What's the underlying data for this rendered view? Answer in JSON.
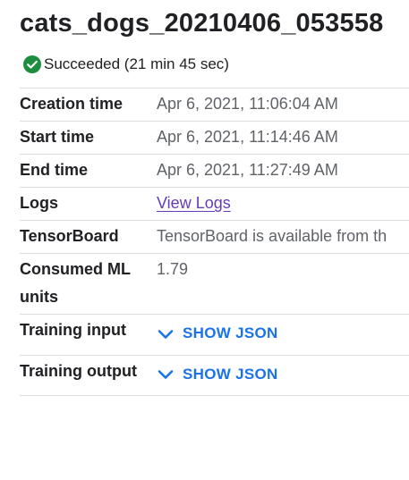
{
  "job": {
    "title": "cats_dogs_20210406_053558",
    "status_text": "Succeeded (21 min 45 sec)",
    "status_icon": "check-circle-icon",
    "status_color": "#1e8e3e"
  },
  "details": {
    "creation_time_label": "Creation time",
    "creation_time_value": "Apr 6, 2021, 11:06:04 AM",
    "start_time_label": "Start time",
    "start_time_value": "Apr 6, 2021, 11:14:46 AM",
    "end_time_label": "End time",
    "end_time_value": "Apr 6, 2021, 11:27:49 AM",
    "logs_label": "Logs",
    "logs_link": "View Logs",
    "tensorboard_label": "TensorBoard",
    "tensorboard_value": "TensorBoard is available from th",
    "ml_units_label": "Consumed ML units",
    "ml_units_value": "1.79",
    "training_input_label": "Training input",
    "training_input_action": "SHOW JSON",
    "training_output_label": "Training output",
    "training_output_action": "SHOW JSON"
  },
  "colors": {
    "link": "#673ab7",
    "action": "#1a73e8",
    "success": "#1e8e3e"
  }
}
